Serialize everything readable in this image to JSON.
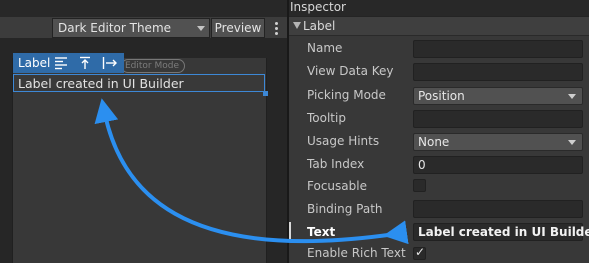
{
  "canvas": {
    "theme_dropdown": {
      "selected": "Dark Editor Theme"
    },
    "preview_label": "Preview",
    "selection_header": {
      "title": "Label"
    },
    "editor_mode_tag": "Editor Mode",
    "selected_label_text": "Label created in UI Builder"
  },
  "inspector": {
    "title": "Inspector",
    "section_title": "Label",
    "fields": {
      "name": {
        "label": "Name",
        "value": ""
      },
      "view_data_key": {
        "label": "View Data Key",
        "value": ""
      },
      "picking_mode": {
        "label": "Picking Mode",
        "value": "Position"
      },
      "tooltip": {
        "label": "Tooltip",
        "value": ""
      },
      "usage_hints": {
        "label": "Usage Hints",
        "value": "None"
      },
      "tab_index": {
        "label": "Tab Index",
        "value": "0"
      },
      "focusable": {
        "label": "Focusable",
        "checked": false
      },
      "binding_path": {
        "label": "Binding Path",
        "value": ""
      },
      "text": {
        "label": "Text",
        "value": "Label created in UI Builder"
      },
      "enable_rich_text": {
        "label": "Enable Rich Text",
        "checked": true
      }
    }
  },
  "colors": {
    "selection_blue": "#2f6ba8",
    "annotation_arrow": "#2b8ff0"
  },
  "icons": [
    "align-left-icon",
    "align-top-icon",
    "stretch-horizontal-icon",
    "kebab-menu-icon",
    "checkmark-icon",
    "dropdown-arrow-icon",
    "foldout-arrow-icon"
  ]
}
